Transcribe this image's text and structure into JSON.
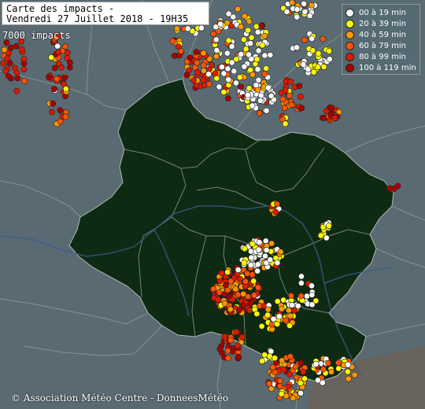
{
  "title_lines": [
    "Carte des impacts -",
    "Vendredi 27 Juillet 2018 - 19H35"
  ],
  "impact_count": "7000 impacts",
  "credit": "© Association Météo Centre - DonneesMétéo",
  "legend": [
    {
      "label": "00 à 19 min",
      "color": "#ffffff"
    },
    {
      "label": "20 à 39 min",
      "color": "#ffff00"
    },
    {
      "label": "40 à 59 min",
      "color": "#ff9900"
    },
    {
      "label": "60 à 79 min",
      "color": "#ff5500"
    },
    {
      "label": "80 à 99 min",
      "color": "#dd1a00"
    },
    {
      "label": "100 à 119 min",
      "color": "#aa0000"
    }
  ],
  "colors": {
    "background": "#5a6a72",
    "region": "#0e2a12",
    "borders": "#8a9a98",
    "rivers": "#3a5a90"
  }
}
